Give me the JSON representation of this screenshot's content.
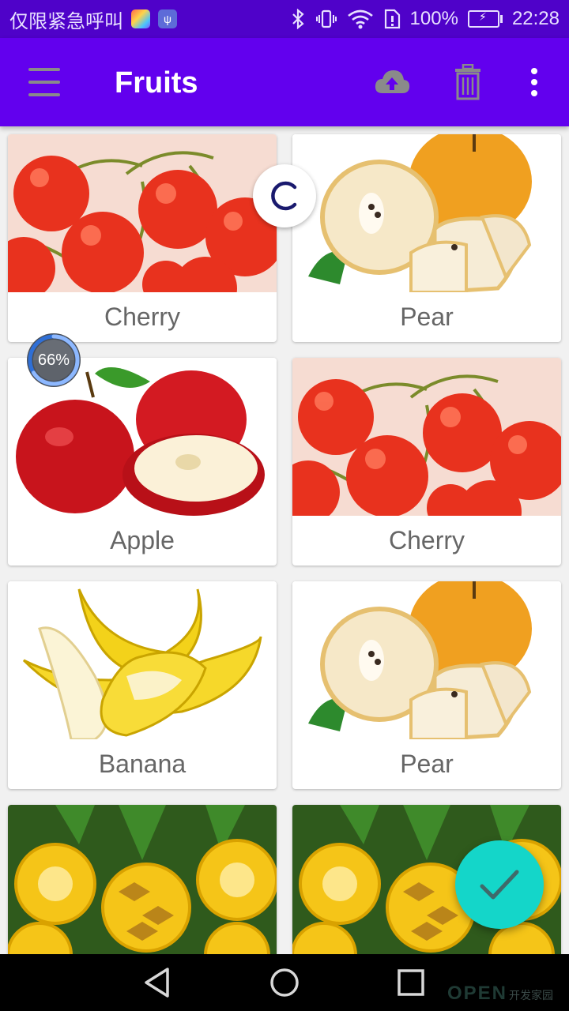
{
  "status_bar": {
    "carrier_text": "仅限紧急呼叫",
    "battery": "100%",
    "time": "22:28",
    "icons": [
      "colorful-app-icon",
      "usb-icon",
      "bluetooth-icon",
      "vibrate-icon",
      "wifi-icon",
      "sim-alert-icon",
      "battery-charging-icon"
    ]
  },
  "app_bar": {
    "title": "Fruits",
    "background": "#6200ee",
    "actions": [
      "menu-icon",
      "cloud-upload-icon",
      "trash-icon",
      "more-vert-icon"
    ]
  },
  "grid": {
    "items": [
      {
        "label": "Cherry",
        "image": "cherry"
      },
      {
        "label": "Pear",
        "image": "pear"
      },
      {
        "label": "Apple",
        "image": "apple"
      },
      {
        "label": "Cherry",
        "image": "cherry"
      },
      {
        "label": "Banana",
        "image": "banana"
      },
      {
        "label": "Pear",
        "image": "pear"
      },
      {
        "label": "",
        "image": "pineapple"
      },
      {
        "label": "",
        "image": "pineapple"
      }
    ]
  },
  "progress": {
    "text": "66%",
    "value": 0.66
  },
  "fab": {
    "icon": "check-icon",
    "color": "#14d6c9"
  },
  "watermark": {
    "brand": "OPEN",
    "suffix": "开发家园"
  }
}
